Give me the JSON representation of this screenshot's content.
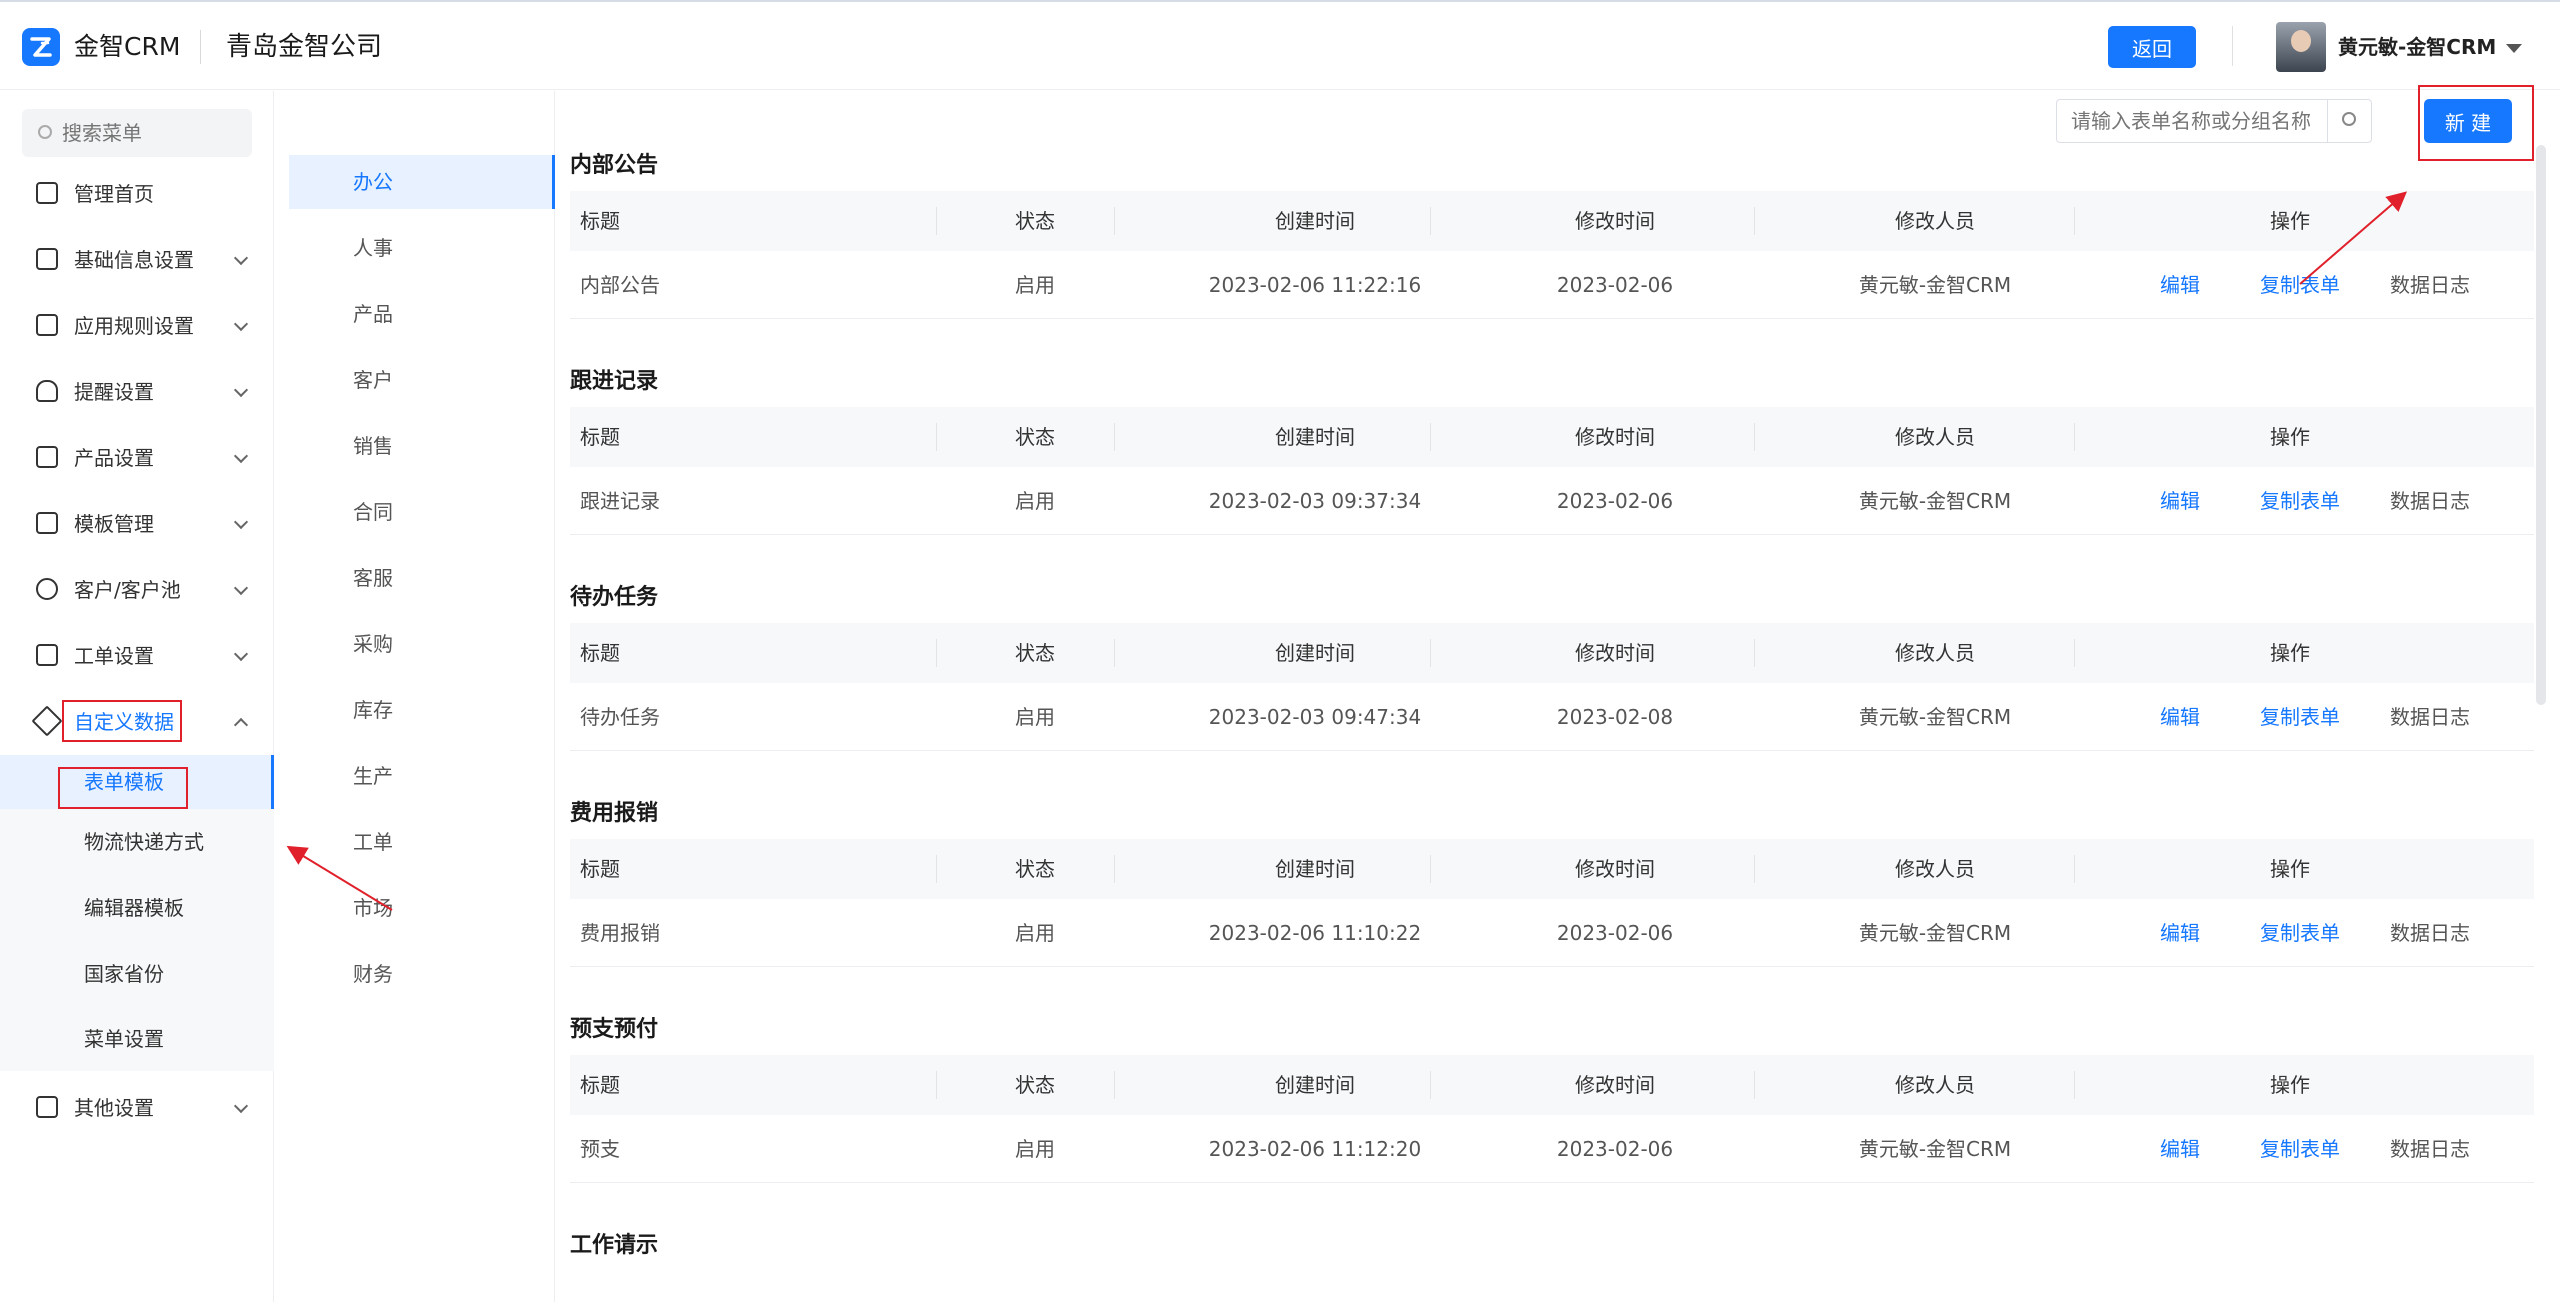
{
  "header": {
    "brand": "金智CRM",
    "company": "青岛金智公司",
    "back_label": "返回",
    "user_name": "黄元敏-金智CRM"
  },
  "sidebar": {
    "search_placeholder": "搜索菜单",
    "items": [
      {
        "label": "管理首页",
        "icon": "home-icon"
      },
      {
        "label": "基础信息设置",
        "icon": "cube-icon"
      },
      {
        "label": "应用规则设置",
        "icon": "document-icon"
      },
      {
        "label": "提醒设置",
        "icon": "bell-icon"
      },
      {
        "label": "产品设置",
        "icon": "box-icon"
      },
      {
        "label": "模板管理",
        "icon": "layout-icon"
      },
      {
        "label": "客户/客户池",
        "icon": "users-icon"
      },
      {
        "label": "工单设置",
        "icon": "list-icon"
      },
      {
        "label": "自定义数据",
        "icon": "tools-icon"
      },
      {
        "label": "其他设置",
        "icon": "grid-icon"
      }
    ],
    "submenu": [
      "表单模板",
      "物流快递方式",
      "编辑器模板",
      "国家省份",
      "菜单设置"
    ]
  },
  "categories": [
    "办公",
    "人事",
    "产品",
    "客户",
    "销售",
    "合同",
    "客服",
    "采购",
    "库存",
    "生产",
    "工单",
    "市场",
    "财务"
  ],
  "main": {
    "search_placeholder": "请输入表单名称或分组名称",
    "new_label": "新 建",
    "columns": [
      "标题",
      "状态",
      "创建时间",
      "修改时间",
      "修改人员",
      "操作"
    ],
    "actions": {
      "edit": "编辑",
      "copy": "复制表单",
      "log": "数据日志"
    },
    "sections": [
      {
        "title": "内部公告",
        "row": {
          "name": "内部公告",
          "status": "启用",
          "created": "2023-02-06 11:22:16",
          "modified": "2023-02-06",
          "modifier": "黄元敏-金智CRM"
        }
      },
      {
        "title": "跟进记录",
        "row": {
          "name": "跟进记录",
          "status": "启用",
          "created": "2023-02-03 09:37:34",
          "modified": "2023-02-06",
          "modifier": "黄元敏-金智CRM"
        }
      },
      {
        "title": "待办任务",
        "row": {
          "name": "待办任务",
          "status": "启用",
          "created": "2023-02-03 09:47:34",
          "modified": "2023-02-08",
          "modifier": "黄元敏-金智CRM"
        }
      },
      {
        "title": "费用报销",
        "row": {
          "name": "费用报销",
          "status": "启用",
          "created": "2023-02-06 11:10:22",
          "modified": "2023-02-06",
          "modifier": "黄元敏-金智CRM"
        }
      },
      {
        "title": "预支预付",
        "row": {
          "name": "预支",
          "status": "启用",
          "created": "2023-02-06 11:12:20",
          "modified": "2023-02-06",
          "modifier": "黄元敏-金智CRM"
        }
      },
      {
        "title": "工作请示"
      }
    ]
  },
  "colors": {
    "accent": "#1677ff",
    "highlight": "#e0202a"
  }
}
